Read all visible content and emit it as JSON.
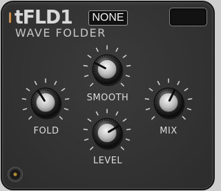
{
  "plugin": {
    "brand": "tFLD1",
    "subtitle": "WAVE FOLDER",
    "accent_color": "#e08a2a"
  },
  "header": {
    "preset_label": "NONE"
  },
  "knobs": [
    {
      "id": "fold",
      "label": "FOLD",
      "value": 0.38
    },
    {
      "id": "smooth",
      "label": "SMOOTH",
      "value": 0.27
    },
    {
      "id": "mix",
      "label": "MIX",
      "value": 0.6
    },
    {
      "id": "level",
      "label": "LEVEL",
      "value": 0.72
    }
  ],
  "icons": {
    "jack": "jack-icon"
  }
}
